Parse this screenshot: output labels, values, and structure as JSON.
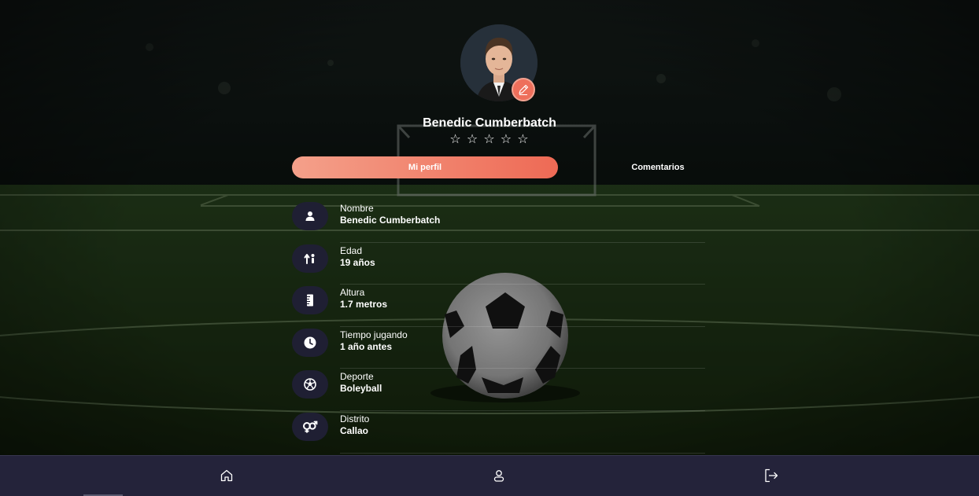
{
  "profile": {
    "name": "Benedic Cumberbatch",
    "rating_stars": [
      "☆",
      "☆",
      "☆",
      "☆",
      "☆"
    ]
  },
  "tabs": {
    "active_label": "Mi perfil",
    "inactive_label": "Comentarios"
  },
  "details": [
    {
      "icon": "user-icon",
      "label": "Nombre",
      "value": "Benedic Cumberbatch"
    },
    {
      "icon": "age-icon",
      "label": "Edad",
      "value": "19 años"
    },
    {
      "icon": "ruler-icon",
      "label": "Altura",
      "value": "1.7 metros"
    },
    {
      "icon": "clock-icon",
      "label": "Tiempo jugando",
      "value": "1 año antes"
    },
    {
      "icon": "ball-icon",
      "label": "Deporte",
      "value": "Boleyball"
    },
    {
      "icon": "gender-icon",
      "label": "Distrito",
      "value": "Callao"
    }
  ],
  "nav": {
    "items": [
      "home-icon",
      "profile-icon",
      "logout-icon"
    ]
  },
  "colors": {
    "accent": "#ee6a55",
    "accent_light": "#f4a08a",
    "nav_bg": "#24233a",
    "icon_bg": "#1f1f33"
  }
}
